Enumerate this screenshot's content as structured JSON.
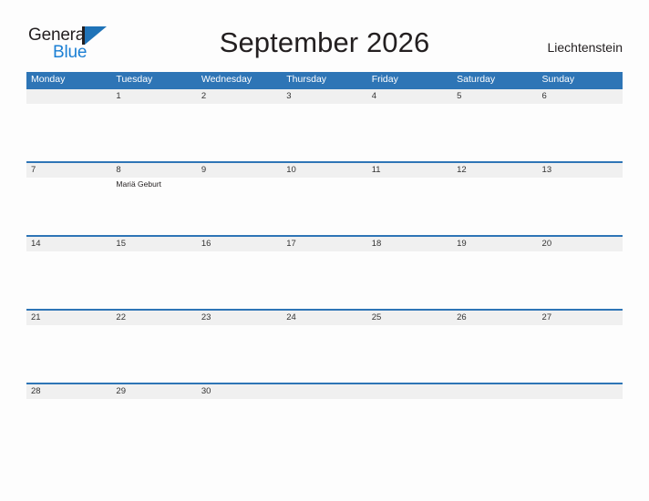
{
  "header": {
    "logo": {
      "word_dark": "General",
      "word_blue": "Blue",
      "icon": "flag-triangle-icon"
    },
    "title": "September 2026",
    "region": "Liechtenstein"
  },
  "colors": {
    "header_blue": "#2e75b6",
    "logo_blue": "#1b7fd4",
    "daynum_band": "#f0f0f0",
    "page_background": "#fdfdfd",
    "text_dark": "#231f20"
  },
  "calendar": {
    "weekdays": [
      "Monday",
      "Tuesday",
      "Wednesday",
      "Thursday",
      "Friday",
      "Saturday",
      "Sunday"
    ],
    "weeks": [
      {
        "days": [
          {
            "num": "",
            "event": ""
          },
          {
            "num": "1",
            "event": ""
          },
          {
            "num": "2",
            "event": ""
          },
          {
            "num": "3",
            "event": ""
          },
          {
            "num": "4",
            "event": ""
          },
          {
            "num": "5",
            "event": ""
          },
          {
            "num": "6",
            "event": ""
          }
        ]
      },
      {
        "days": [
          {
            "num": "7",
            "event": ""
          },
          {
            "num": "8",
            "event": "Mariä Geburt"
          },
          {
            "num": "9",
            "event": ""
          },
          {
            "num": "10",
            "event": ""
          },
          {
            "num": "11",
            "event": ""
          },
          {
            "num": "12",
            "event": ""
          },
          {
            "num": "13",
            "event": ""
          }
        ]
      },
      {
        "days": [
          {
            "num": "14",
            "event": ""
          },
          {
            "num": "15",
            "event": ""
          },
          {
            "num": "16",
            "event": ""
          },
          {
            "num": "17",
            "event": ""
          },
          {
            "num": "18",
            "event": ""
          },
          {
            "num": "19",
            "event": ""
          },
          {
            "num": "20",
            "event": ""
          }
        ]
      },
      {
        "days": [
          {
            "num": "21",
            "event": ""
          },
          {
            "num": "22",
            "event": ""
          },
          {
            "num": "23",
            "event": ""
          },
          {
            "num": "24",
            "event": ""
          },
          {
            "num": "25",
            "event": ""
          },
          {
            "num": "26",
            "event": ""
          },
          {
            "num": "27",
            "event": ""
          }
        ]
      },
      {
        "days": [
          {
            "num": "28",
            "event": ""
          },
          {
            "num": "29",
            "event": ""
          },
          {
            "num": "30",
            "event": ""
          },
          {
            "num": "",
            "event": ""
          },
          {
            "num": "",
            "event": ""
          },
          {
            "num": "",
            "event": ""
          },
          {
            "num": "",
            "event": ""
          }
        ]
      }
    ]
  }
}
